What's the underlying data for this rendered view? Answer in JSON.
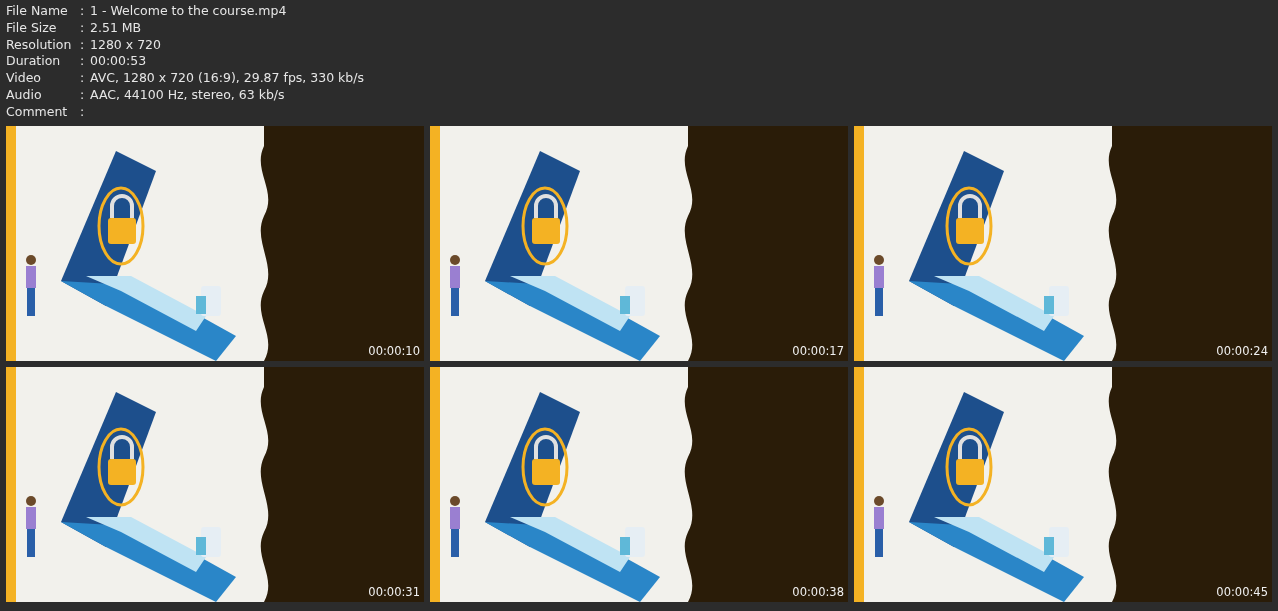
{
  "info": [
    {
      "label": "File Name",
      "sep": ":",
      "value": "1 - Welcome to the course.mp4"
    },
    {
      "label": "File Size",
      "sep": ":",
      "value": "2.51 MB"
    },
    {
      "label": "Resolution",
      "sep": ":",
      "value": "1280 x 720"
    },
    {
      "label": "Duration",
      "sep": ":",
      "value": "00:00:53"
    },
    {
      "label": "Video",
      "sep": ":",
      "value": "AVC, 1280 x 720 (16:9), 29.87 fps, 330 kb/s"
    },
    {
      "label": "Audio",
      "sep": ":",
      "value": "AAC, 44100 Hz, stereo, 63 kb/s"
    },
    {
      "label": "Comment",
      "sep": ":"
    }
  ],
  "thumbnails": [
    {
      "kind": "picture",
      "time": "00:00:10"
    },
    {
      "kind": "picture",
      "time": "00:00:17"
    },
    {
      "kind": "picture",
      "time": "00:00:24"
    },
    {
      "kind": "picture",
      "time": "00:00:31"
    },
    {
      "kind": "picture",
      "time": "00:00:38"
    },
    {
      "kind": "picture",
      "time": "00:00:45"
    }
  ]
}
